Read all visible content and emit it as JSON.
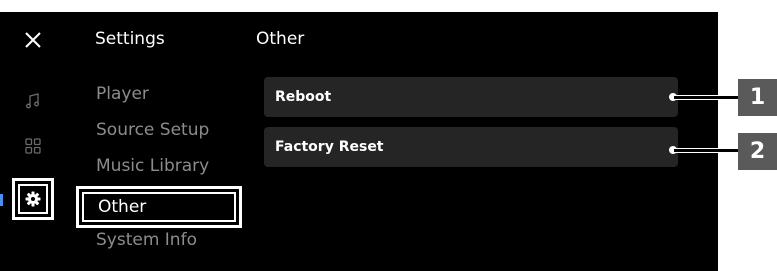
{
  "header": {
    "close_icon": "close-icon",
    "title": "Settings",
    "section_title": "Other"
  },
  "rail": {
    "icons": [
      "music-note-icon",
      "grid-icon",
      "gear-icon"
    ]
  },
  "menu": {
    "items": [
      {
        "label": "Player"
      },
      {
        "label": "Source Setup"
      },
      {
        "label": "Music Library"
      },
      {
        "label": "Other"
      },
      {
        "label": "System Info"
      }
    ],
    "selected": "Other"
  },
  "actions": [
    {
      "label": "Reboot"
    },
    {
      "label": "Factory Reset"
    }
  ],
  "callouts": [
    "1",
    "2"
  ],
  "colors": {
    "screen_bg": "#000000",
    "button_bg": "#252525",
    "muted_text": "#8c8c8c",
    "callout_bg": "#5a5a5a",
    "accent": "#4c8df6"
  }
}
